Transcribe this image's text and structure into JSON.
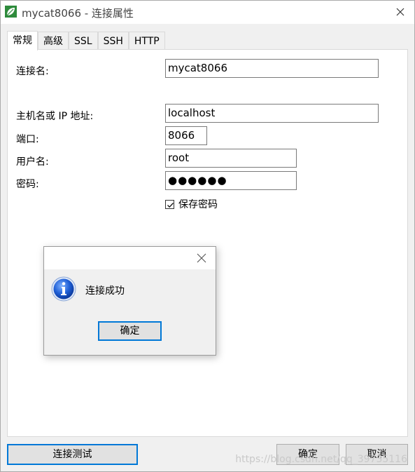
{
  "window": {
    "title": "mycat8066 - 连接属性",
    "accent_color": "#0078d7",
    "app_icon": "navicat-leaf-icon"
  },
  "tabs": [
    {
      "label": "常规",
      "active": true
    },
    {
      "label": "高级",
      "active": false
    },
    {
      "label": "SSL",
      "active": false
    },
    {
      "label": "SSH",
      "active": false
    },
    {
      "label": "HTTP",
      "active": false
    }
  ],
  "form": {
    "connection_name": {
      "label": "连接名:",
      "value": "mycat8066"
    },
    "host": {
      "label": "主机名或 IP 地址:",
      "value": "localhost"
    },
    "port": {
      "label": "端口:",
      "value": "8066"
    },
    "username": {
      "label": "用户名:",
      "value": "root"
    },
    "password": {
      "label": "密码:",
      "value": "●●●●●●"
    },
    "save_password": {
      "label": "保存密码",
      "checked": true
    }
  },
  "buttons": {
    "test_connection": "连接测试",
    "ok": "确定",
    "cancel": "取消"
  },
  "dialog": {
    "message": "连接成功",
    "ok": "确定",
    "icon": "info-icon"
  },
  "watermark": "https://blog.csdn.net/qq_39735116"
}
